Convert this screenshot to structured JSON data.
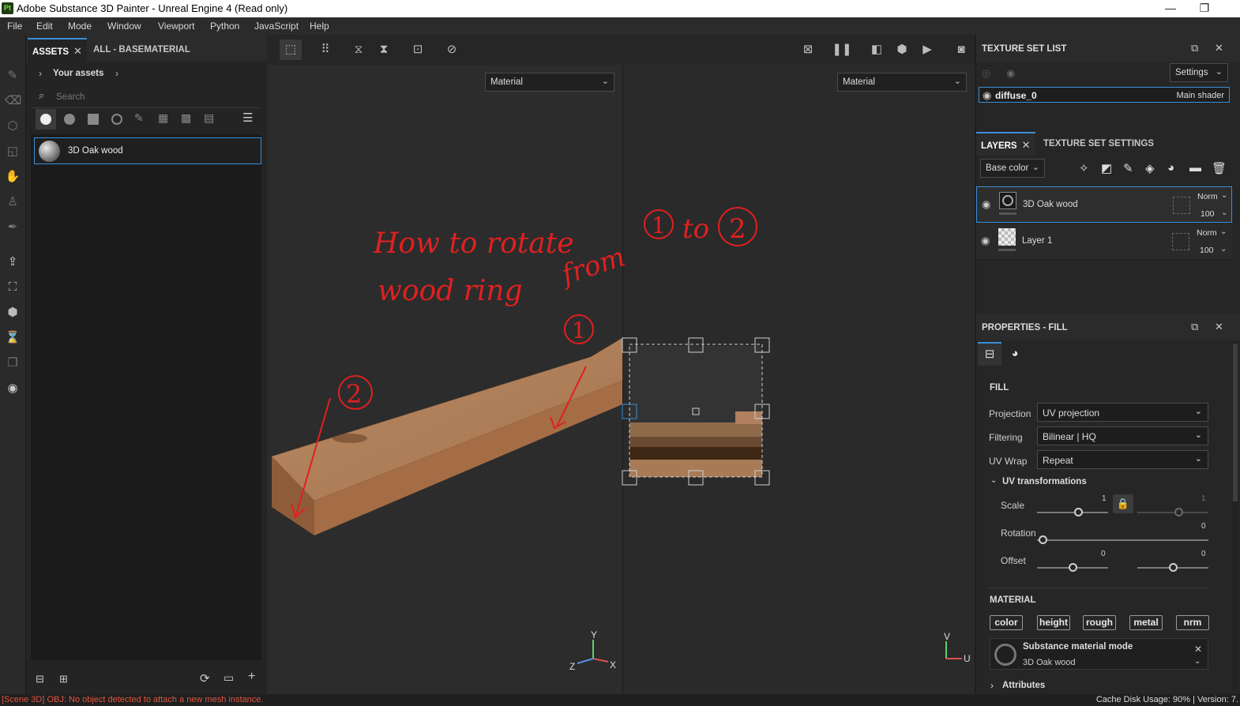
{
  "titlebar": {
    "logo": "Pt",
    "title": "Adobe Substance 3D Painter - Unreal Engine 4 (Read only)",
    "minimize": "—",
    "restore": "❐"
  },
  "menu": [
    "File",
    "Edit",
    "Mode",
    "Window",
    "Viewport",
    "Python",
    "JavaScript",
    "Help"
  ],
  "assets": {
    "tab_active": "ASSETS",
    "tab_other": "ALL - BASEMATERIAL",
    "breadcrumb": "Your assets",
    "search_placeholder": "Search",
    "items": [
      {
        "name": "3D Oak wood"
      }
    ]
  },
  "viewport": {
    "left_dropdown": "Material",
    "right_dropdown": "Material",
    "annotation_title_line1": "How to rotate",
    "annotation_title_line2": "wood ring",
    "annotation_from": "from",
    "annotation_to": "to",
    "marker1": "1",
    "marker2": "2",
    "axis3d": {
      "x": "X",
      "y": "Y",
      "z": "Z"
    },
    "axis2d": {
      "v": "V",
      "u": "U"
    }
  },
  "texture_set_list": {
    "title": "TEXTURE SET LIST",
    "settings": "Settings",
    "item_name": "diffuse_0",
    "item_shader": "Main shader"
  },
  "layers": {
    "tab_active": "LAYERS",
    "tab_other": "TEXTURE SET SETTINGS",
    "channel": "Base color",
    "rows": [
      {
        "name": "3D Oak wood",
        "blend": "Norm",
        "opacity": "100"
      },
      {
        "name": "Layer 1",
        "blend": "Norm",
        "opacity": "100"
      }
    ]
  },
  "properties": {
    "title": "PROPERTIES - FILL",
    "fill_heading": "FILL",
    "projection_label": "Projection",
    "projection_value": "UV projection",
    "filtering_label": "Filtering",
    "filtering_value": "Bilinear | HQ",
    "uvwrap_label": "UV Wrap",
    "uvwrap_value": "Repeat",
    "uvtrans_heading": "UV transformations",
    "scale_label": "Scale",
    "scale_value": "1",
    "scale_value2": "1",
    "rotation_label": "Rotation",
    "rotation_value": "0",
    "offset_label": "Offset",
    "offset_value1": "0",
    "offset_value2": "0",
    "material_heading": "MATERIAL",
    "channels": [
      "color",
      "height",
      "rough",
      "metal",
      "nrm"
    ],
    "material_mode_title": "Substance material mode",
    "material_mode_value": "3D Oak wood",
    "attributes_heading": "Attributes"
  },
  "status": {
    "message": "[Scene 3D] OBJ: No object detected to attach a new mesh instance.",
    "right": "Cache Disk Usage:   90%  |  Version: 7."
  },
  "colors": {
    "accent": "#3a8fd8",
    "annotation": "#e02020",
    "error_text": "#e2543e"
  }
}
